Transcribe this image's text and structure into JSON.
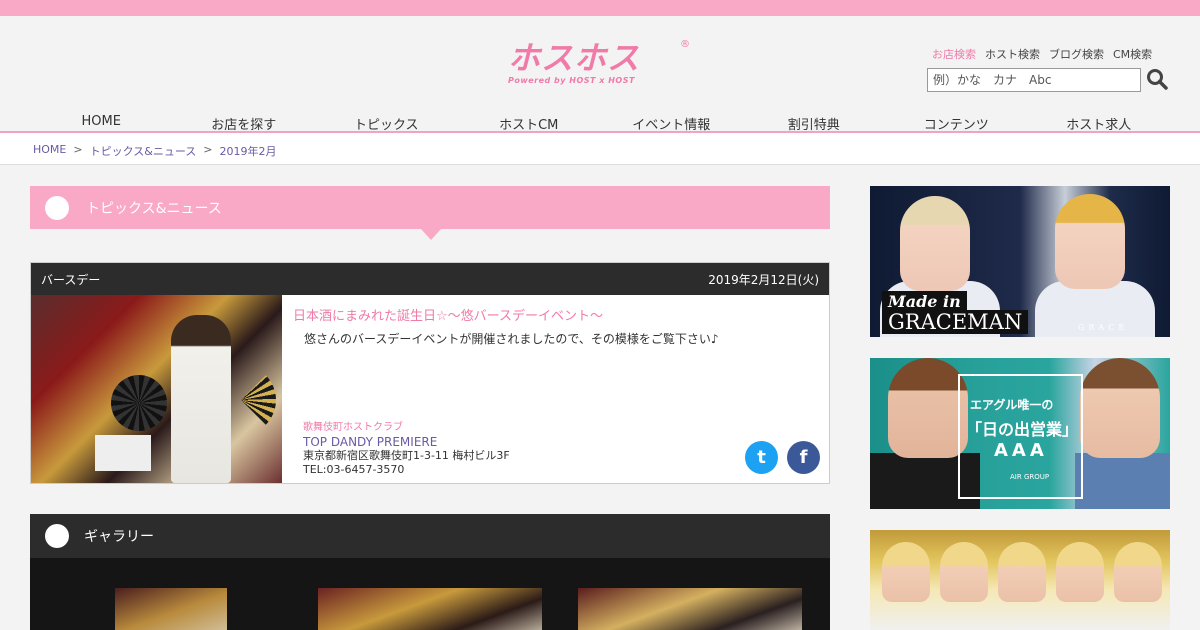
{
  "logo": {
    "text": "ホスホス",
    "sub": "Powered by HOST x HOST",
    "reg": "®"
  },
  "search": {
    "tabs": [
      "お店検索",
      "ホスト検索",
      "ブログ検索",
      "CM検索"
    ],
    "active_tab": "お店検索",
    "placeholder": "例）かな　カナ　Abc",
    "button_icon": "search-icon"
  },
  "nav": {
    "items": [
      "HOME",
      "お店を探す",
      "トピックス",
      "ホストCM",
      "イベント情報",
      "割引特典",
      "コンテンツ",
      "ホスト求人"
    ]
  },
  "breadcrumb": {
    "items": [
      "HOME",
      "トピックス&ニュース",
      "2019年2月"
    ],
    "separator": ">"
  },
  "section": {
    "title": "トピックス&ニュース"
  },
  "article": {
    "category": "バースデー",
    "date": "2019年2月12日(火)",
    "title": "日本酒にまみれた誕生日☆～悠バースデーイベント～",
    "description": "悠さんのバースデーイベントが開催されましたので、その模様をご覧下さい♪",
    "shop_category": "歌舞伎町ホストクラブ",
    "shop_name": "TOP DANDY PREMIERE",
    "shop_address": "東京都新宿区歌舞伎町1-3-11 梅村ビル3F",
    "shop_tel": "TEL:03-6457-3570",
    "share": {
      "twitter_icon": "twitter-icon",
      "facebook_icon": "facebook-icon",
      "twitter_glyph": "t",
      "facebook_glyph": "f"
    }
  },
  "gallery": {
    "title": "ギャラリー"
  },
  "sidebar": {
    "banner1": {
      "made_in": "Made in",
      "title": "GRACEMAN",
      "brand": "GRACE"
    },
    "banner2": {
      "line1": "エアグル唯一の",
      "line2": "「日の出営業」",
      "line3": "AAA",
      "line4": "AIR GROUP"
    }
  },
  "colors": {
    "pink": "#f9a8c6",
    "pink_text": "#f07aa8",
    "purple_link": "#6a5aa5",
    "dark": "#2c2c2c",
    "twitter": "#1da1f2",
    "facebook": "#3b5998"
  }
}
